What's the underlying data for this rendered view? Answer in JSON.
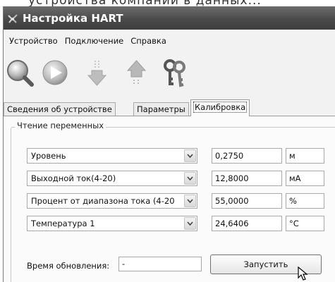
{
  "background_text": "устройства компании в данных...",
  "window": {
    "title": "Настройка HART",
    "icon": "app-icon"
  },
  "menu": [
    "Устройство",
    "Подключение",
    "Справка"
  ],
  "toolbar": {
    "buttons": [
      {
        "icon": "search-icon"
      },
      {
        "icon": "play-icon"
      },
      {
        "icon": "download-arrow-icon"
      },
      {
        "icon": "upload-arrow-icon"
      },
      {
        "icon": "keys-icon"
      }
    ]
  },
  "tabs": [
    {
      "label": "Сведения об устройстве",
      "active": false
    },
    {
      "label": "Параметры",
      "active": false
    },
    {
      "label": "Калибровка",
      "active": true
    }
  ],
  "group": {
    "title": "Чтение переменных",
    "rows": [
      {
        "variable": "Уровень",
        "value": "0,2750",
        "unit": "м"
      },
      {
        "variable": "Выходной ток(4-20)",
        "value": "12,8000",
        "unit": "мА"
      },
      {
        "variable": "Процент от диапазона тока (4-20",
        "value": "55,0000",
        "unit": "%"
      },
      {
        "variable": "Температура 1",
        "value": "24,6406",
        "unit": "°С"
      }
    ],
    "update_label": "Время обновления:",
    "update_value": "-",
    "run_button": "Запустить"
  },
  "colors": {
    "titlebar": "#4a4a4a",
    "window_bg": "#f2f2f2",
    "panel_bg": "#fbfbfb"
  }
}
